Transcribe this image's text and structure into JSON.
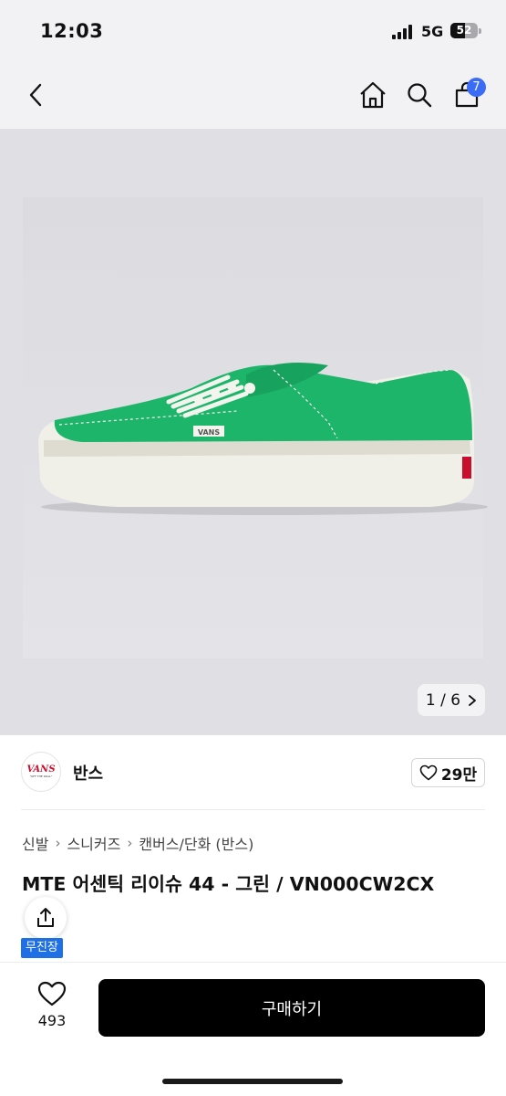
{
  "status_bar": {
    "time": "12:03",
    "network": "5G",
    "battery": 52
  },
  "nav": {
    "cart_count": "7",
    "icons": [
      "back-icon",
      "home-icon",
      "search-icon",
      "cart-icon"
    ]
  },
  "gallery": {
    "current": "1",
    "total": "6",
    "pager_label": "1 / 6"
  },
  "brand": {
    "name": "반스",
    "logo_text": "VANS",
    "logo_subtext": "\"OFF THE WALL\"",
    "like_count": "29만"
  },
  "breadcrumb": [
    "신발",
    "스니커즈",
    "캔버스/단화 (반스)"
  ],
  "product": {
    "title": "MTE 어센틱 리이슈 44 - 그린 / VN000CW2CX",
    "tag": "무진장"
  },
  "bottom_bar": {
    "wish_count": "493",
    "buy_label": "구매하기"
  },
  "colors": {
    "accent_blue": "#3b6cf6",
    "tag_blue": "#1f6fe5",
    "shoe_green": "#1db56a",
    "vans_red": "#c8102e"
  }
}
